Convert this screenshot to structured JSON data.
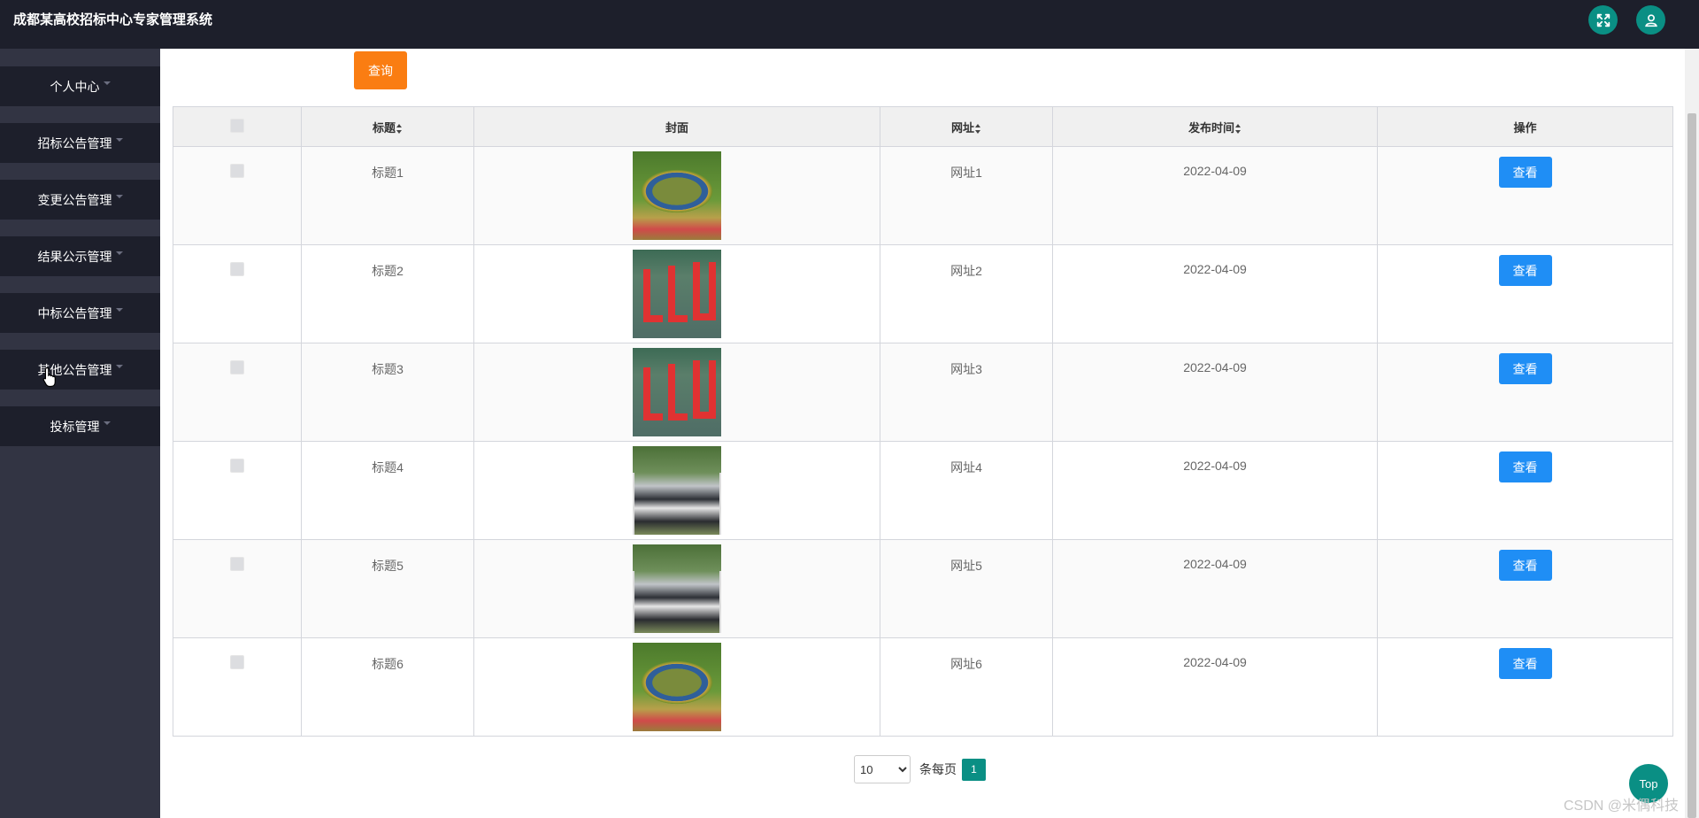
{
  "app": {
    "title": "成都某高校招标中心专家管理系统"
  },
  "header": {
    "icons": [
      "fullscreen-icon",
      "user-icon"
    ]
  },
  "sidebar": {
    "items": [
      {
        "label": "个人中心"
      },
      {
        "label": "招标公告管理"
      },
      {
        "label": "变更公告管理"
      },
      {
        "label": "结果公示管理"
      },
      {
        "label": "中标公告管理"
      },
      {
        "label": "其他公告管理"
      },
      {
        "label": "投标管理"
      }
    ]
  },
  "toolbar": {
    "query_label": "查询"
  },
  "table": {
    "columns": [
      "",
      "标题",
      "封面",
      "网址",
      "发布时间",
      "操作"
    ],
    "sortable": [
      false,
      true,
      false,
      true,
      true,
      false
    ],
    "rows": [
      {
        "title": "标题1",
        "cover": "circle-formation-photo",
        "url": "网址1",
        "date": "2022-04-09",
        "action": "查看"
      },
      {
        "title": "标题2",
        "cover": "red-letters-formation-photo",
        "url": "网址2",
        "date": "2022-04-09",
        "action": "查看"
      },
      {
        "title": "标题3",
        "cover": "red-letters-formation-photo",
        "url": "网址3",
        "date": "2022-04-09",
        "action": "查看"
      },
      {
        "title": "标题4",
        "cover": "group-photo",
        "url": "网址4",
        "date": "2022-04-09",
        "action": "查看"
      },
      {
        "title": "标题5",
        "cover": "group-photo",
        "url": "网址5",
        "date": "2022-04-09",
        "action": "查看"
      },
      {
        "title": "标题6",
        "cover": "circle-formation-photo",
        "url": "网址6",
        "date": "2022-04-09",
        "action": "查看"
      }
    ]
  },
  "pagination": {
    "page_size": "10",
    "page_size_options": [
      "10"
    ],
    "label": "条每页",
    "current_page": "1"
  },
  "floating": {
    "top_label": "Top"
  },
  "watermark": "CSDN @米偶科技",
  "colors": {
    "accent": "#0a8f84",
    "query": "#fa7d12",
    "view": "#1f8ef5",
    "topbar": "#1d1f2b",
    "sidebar": "#323443"
  }
}
